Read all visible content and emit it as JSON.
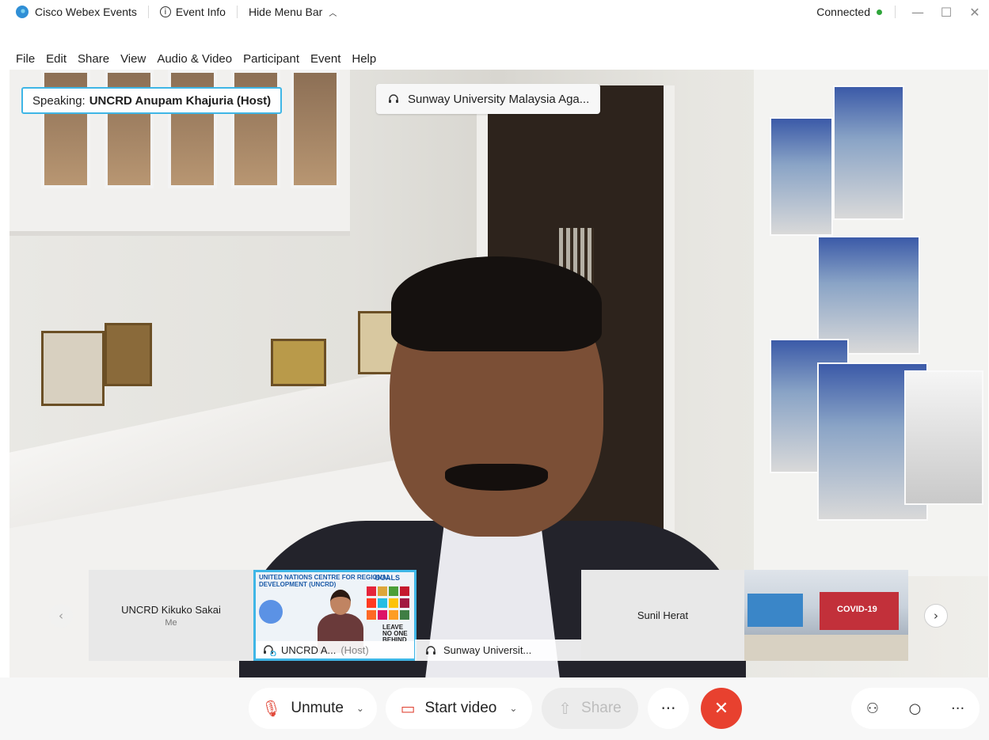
{
  "titlebar": {
    "app_name": "Cisco Webex Events",
    "event_info": "Event Info",
    "hide_menu": "Hide Menu Bar",
    "status": "Connected",
    "status_color": "#2fa53b"
  },
  "menu": [
    "File",
    "Edit",
    "Share",
    "View",
    "Audio & Video",
    "Participant",
    "Event",
    "Help"
  ],
  "video": {
    "speaking_prefix": "Speaking:",
    "speaker": "UNCRD Anupam Khajuria (Host)",
    "active_source": "Sunway University Malaysia Aga..."
  },
  "filmstrip": [
    {
      "name": "UNCRD Kikuko Sakai",
      "sub": "Me"
    },
    {
      "name": "UNCRD A...",
      "sub": "(Host)",
      "slide_text": "UNITED NATIONS CENTRE FOR REGIONAL DEVELOPMENT (UNCRD)",
      "slide_goals": "GOALS",
      "slide_leave": "LEAVE NO ONE BEHIND"
    },
    {
      "name": "Sunway Universit..."
    },
    {
      "name": "Sunil Herat"
    },
    {
      "name": "",
      "slide_text": "COVID-19"
    }
  ],
  "toolbar": {
    "unmute": "Unmute",
    "start_video": "Start video",
    "share": "Share",
    "more": "···",
    "accent_color": "#e8412f"
  }
}
